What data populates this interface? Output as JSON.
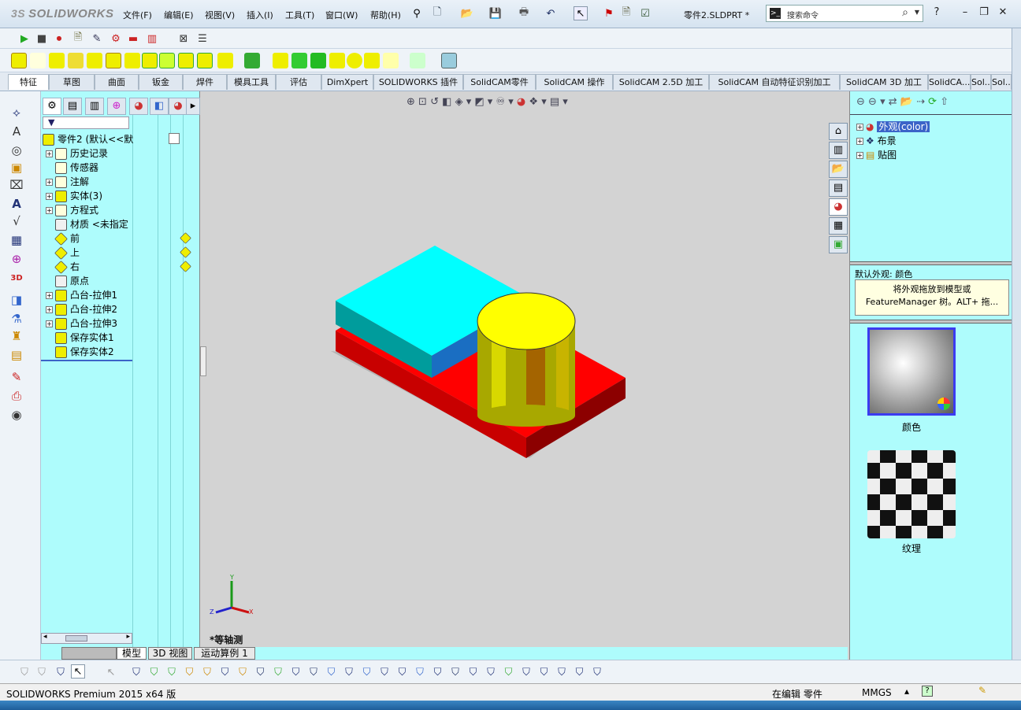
{
  "app": {
    "logo": "SOLIDWORKS",
    "doc_title": "零件2.SLDPRT *"
  },
  "menu": [
    "文件(F)",
    "编辑(E)",
    "视图(V)",
    "插入(I)",
    "工具(T)",
    "窗口(W)",
    "帮助(H)"
  ],
  "search": {
    "placeholder": "搜索命令"
  },
  "tabs": [
    "特征",
    "草图",
    "曲面",
    "钣金",
    "焊件",
    "模具工具",
    "评估",
    "DimXpert",
    "SOLIDWORKS 插件",
    "SolidCAM零件",
    "SolidCAM 操作",
    "SolidCAM 2.5D 加工",
    "SolidCAM 自动特征识别加工",
    "SolidCAM 3D 加工",
    "SolidCA...",
    "Sol...",
    "Sol..."
  ],
  "active_tab": "特征",
  "feature_tree": {
    "root": "零件2  (默认<<默",
    "items": [
      {
        "label": "历史记录",
        "icon": "history-icon",
        "expand": true
      },
      {
        "label": "传感器",
        "icon": "sensor-icon",
        "expand": false
      },
      {
        "label": "注解",
        "icon": "annotation-icon",
        "expand": true
      },
      {
        "label": "实体(3)",
        "icon": "solid-bodies-icon",
        "expand": true
      },
      {
        "label": "方程式",
        "icon": "equation-icon",
        "expand": true
      },
      {
        "label": "材质 <未指定",
        "icon": "material-icon",
        "expand": false
      },
      {
        "label": "前",
        "icon": "plane-icon",
        "expand": false
      },
      {
        "label": "上",
        "icon": "plane-icon",
        "expand": false
      },
      {
        "label": "右",
        "icon": "plane-icon",
        "expand": false
      },
      {
        "label": "原点",
        "icon": "origin-icon",
        "expand": false
      },
      {
        "label": "凸台-拉伸1",
        "icon": "boss-extrude-icon",
        "expand": true
      },
      {
        "label": "凸台-拉伸2",
        "icon": "boss-extrude-icon",
        "expand": true
      },
      {
        "label": "凸台-拉伸3",
        "icon": "boss-extrude-icon",
        "expand": true
      },
      {
        "label": "保存实体1",
        "icon": "save-bodies-icon",
        "expand": false
      },
      {
        "label": "保存实体2",
        "icon": "save-bodies-icon",
        "expand": false
      }
    ]
  },
  "viewport": {
    "view_label": "*等轴测"
  },
  "bottom_tabs": [
    "模型",
    "3D 视图",
    "运动算例 1"
  ],
  "task_pane": {
    "tree": [
      "外观(color)",
      "布景",
      "贴图"
    ],
    "desc_title": "默认外观: 颜色",
    "tooltip": [
      "将外观拖放到模型或",
      "FeatureManager 树。ALT+ 拖..."
    ],
    "thumbs": [
      "颜色",
      "纹理"
    ]
  },
  "status": {
    "product": "SOLIDWORKS Premium 2015 x64 版",
    "mode": "在编辑 零件",
    "units": "MMGS"
  },
  "colors": {
    "cyan_panel": "#aefcfc",
    "block_top": "#00ffff",
    "base_red": "#ff0000",
    "cylinder_yellow": "#ffff00"
  }
}
